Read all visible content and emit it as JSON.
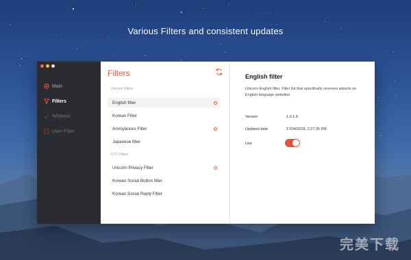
{
  "headline": "Various Filters and consistent updates",
  "window": {
    "traffic_colors": [
      "#ff5f56",
      "#ffbd2e",
      "#e6e6e6"
    ]
  },
  "sidebar": {
    "items": [
      {
        "label": "Main",
        "icon": "target-icon",
        "state": "normal"
      },
      {
        "label": "Filters",
        "icon": "filter-icon",
        "state": "active"
      },
      {
        "label": "Whitelist",
        "icon": "check-icon",
        "state": "dim"
      },
      {
        "label": "User Filter",
        "icon": "user-filter-icon",
        "state": "dim"
      }
    ]
  },
  "filters": {
    "title": "Filters",
    "refresh_icon": "refresh-icon",
    "sections": [
      {
        "label": "Unicorn Filters",
        "items": [
          {
            "label": "English filter",
            "selected": true,
            "indicator": true
          },
          {
            "label": "Korean Filter",
            "selected": false,
            "indicator": false
          },
          {
            "label": "Annoyances Filter",
            "selected": false,
            "indicator": true
          },
          {
            "label": "Japanese filter",
            "selected": false,
            "indicator": false
          }
        ]
      },
      {
        "label": "ETC Filters",
        "items": [
          {
            "label": "Unicorn Privacy Filter",
            "selected": false,
            "indicator": true
          },
          {
            "label": "Korean Social Button filter",
            "selected": false,
            "indicator": false
          },
          {
            "label": "Korean Social Reply Filter",
            "selected": false,
            "indicator": false
          }
        ]
      }
    ]
  },
  "detail": {
    "title": "English filter",
    "description": "Unicorn English filter. Filter list that specifically removes adverts on English language websites.",
    "version_label": "Version",
    "version_value": "1.0.1.9",
    "updated_label": "Updated date",
    "updated_value": "17/04/2018, 2:27:35 PM",
    "use_label": "Use",
    "use_enabled": true
  },
  "watermark": "完美下载",
  "colors": {
    "accent": "#e0573f",
    "sidebar_bg": "#2b2c31"
  }
}
